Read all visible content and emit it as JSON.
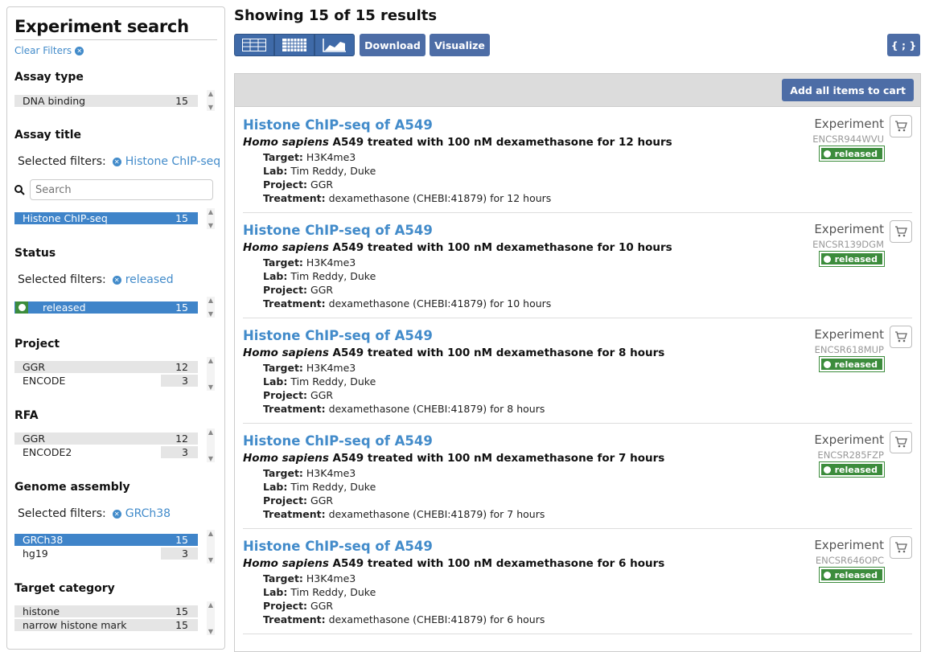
{
  "sidebar": {
    "title": "Experiment search",
    "clear_filters": "Clear Filters",
    "facets": {
      "assay_type": {
        "title": "Assay type",
        "terms": [
          {
            "label": "DNA binding",
            "count": "15"
          }
        ]
      },
      "assay_title": {
        "title": "Assay title",
        "selected_label": "Selected filters:",
        "selected_value": "Histone ChIP-seq",
        "search_placeholder": "Search",
        "terms": [
          {
            "label": "Histone ChIP-seq",
            "count": "15"
          }
        ]
      },
      "status": {
        "title": "Status",
        "selected_label": "Selected filters:",
        "selected_value": "released",
        "terms": [
          {
            "label": "released",
            "count": "15"
          }
        ]
      },
      "project": {
        "title": "Project",
        "terms": [
          {
            "label": "GGR",
            "count": "12"
          },
          {
            "label": "ENCODE",
            "count": "3"
          }
        ]
      },
      "rfa": {
        "title": "RFA",
        "terms": [
          {
            "label": "GGR",
            "count": "12"
          },
          {
            "label": "ENCODE2",
            "count": "3"
          }
        ]
      },
      "genome_assembly": {
        "title": "Genome assembly",
        "selected_label": "Selected filters:",
        "selected_value": "GRCh38",
        "terms": [
          {
            "label": "GRCh38",
            "count": "15"
          },
          {
            "label": "hg19",
            "count": "3"
          }
        ]
      },
      "target_category": {
        "title": "Target category",
        "terms": [
          {
            "label": "histone",
            "count": "15"
          },
          {
            "label": "narrow histone mark",
            "count": "15"
          }
        ]
      }
    }
  },
  "main": {
    "heading": "Showing 15 of 15 results",
    "toolbar": {
      "download": "Download",
      "visualize": "Visualize",
      "json": "{ ; }"
    },
    "add_all": "Add all items to cart",
    "results": [
      {
        "title": "Histone ChIP-seq of A549",
        "species": "Homo sapiens",
        "desc": " A549 treated with 100 nM dexamethasone for 12 hours",
        "target_label": "Target:",
        "target": " H3K4me3",
        "lab_label": "Lab:",
        "lab": " Tim Reddy, Duke",
        "project_label": "Project:",
        "project": " GGR",
        "treatment_label": "Treatment:",
        "treatment": " dexamethasone (CHEBI:41879) for 12 hours",
        "type": "Experiment",
        "accession": "ENCSR944WVU",
        "status": "released"
      },
      {
        "title": "Histone ChIP-seq of A549",
        "species": "Homo sapiens",
        "desc": " A549 treated with 100 nM dexamethasone for 10 hours",
        "target_label": "Target:",
        "target": " H3K4me3",
        "lab_label": "Lab:",
        "lab": " Tim Reddy, Duke",
        "project_label": "Project:",
        "project": " GGR",
        "treatment_label": "Treatment:",
        "treatment": " dexamethasone (CHEBI:41879) for 10 hours",
        "type": "Experiment",
        "accession": "ENCSR139DGM",
        "status": "released"
      },
      {
        "title": "Histone ChIP-seq of A549",
        "species": "Homo sapiens",
        "desc": " A549 treated with 100 nM dexamethasone for 8 hours",
        "target_label": "Target:",
        "target": " H3K4me3",
        "lab_label": "Lab:",
        "lab": " Tim Reddy, Duke",
        "project_label": "Project:",
        "project": " GGR",
        "treatment_label": "Treatment:",
        "treatment": " dexamethasone (CHEBI:41879) for 8 hours",
        "type": "Experiment",
        "accession": "ENCSR618MUP",
        "status": "released"
      },
      {
        "title": "Histone ChIP-seq of A549",
        "species": "Homo sapiens",
        "desc": " A549 treated with 100 nM dexamethasone for 7 hours",
        "target_label": "Target:",
        "target": " H3K4me3",
        "lab_label": "Lab:",
        "lab": " Tim Reddy, Duke",
        "project_label": "Project:",
        "project": " GGR",
        "treatment_label": "Treatment:",
        "treatment": " dexamethasone (CHEBI:41879) for 7 hours",
        "type": "Experiment",
        "accession": "ENCSR285FZP",
        "status": "released"
      },
      {
        "title": "Histone ChIP-seq of A549",
        "species": "Homo sapiens",
        "desc": " A549 treated with 100 nM dexamethasone for 6 hours",
        "target_label": "Target:",
        "target": " H3K4me3",
        "lab_label": "Lab:",
        "lab": " Tim Reddy, Duke",
        "project_label": "Project:",
        "project": " GGR",
        "treatment_label": "Treatment:",
        "treatment": " dexamethasone (CHEBI:41879) for 6 hours",
        "type": "Experiment",
        "accession": "ENCSR646OPC",
        "status": "released"
      }
    ]
  },
  "colors": {
    "link": "#428bca",
    "button": "#4d6da6",
    "status_released": "#3c8c3c",
    "selected_term": "#3f84c9"
  }
}
